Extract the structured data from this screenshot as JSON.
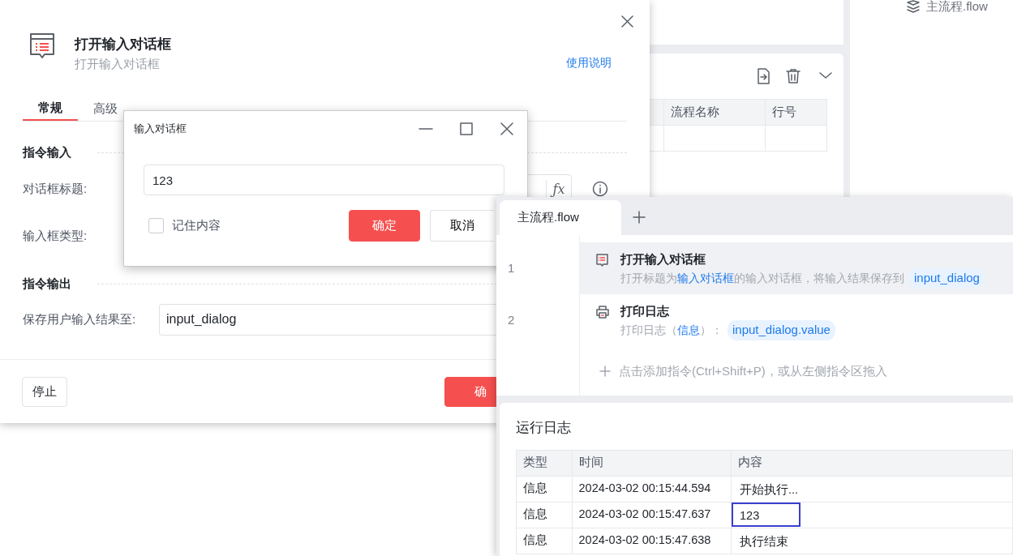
{
  "background_app": {
    "sidebar_file": "主流程.flow",
    "table": {
      "columns": [
        "流程名称",
        "行号"
      ]
    }
  },
  "instruction_dialog": {
    "title": "打开输入对话框",
    "subtitle": "打开输入对话框",
    "help_link": "使用说明",
    "tabs": [
      {
        "label": "常规",
        "selected": true
      },
      {
        "label": "高级",
        "selected": false
      }
    ],
    "sections": [
      {
        "title": "指令输入",
        "fields": [
          {
            "label": "对话框标题:",
            "kind": "expression",
            "fx": "ƒx"
          },
          {
            "label": "输入框类型:",
            "kind": "select"
          }
        ]
      },
      {
        "title": "指令输出",
        "fields": [
          {
            "label": "保存用户输入结果至:",
            "kind": "text",
            "value": "input_dialog"
          }
        ]
      }
    ],
    "buttons": [
      {
        "label": "停止",
        "kind": "default"
      },
      {
        "label": "确",
        "kind": "primary"
      }
    ]
  },
  "input_dialog": {
    "title": "输入对话框",
    "value": "123",
    "remember": {
      "label": "记住内容",
      "checked": false
    },
    "buttons": [
      {
        "label": "确定",
        "kind": "primary"
      },
      {
        "label": "取消",
        "kind": "default"
      }
    ]
  },
  "editor": {
    "tabs": [
      {
        "label": "主流程.flow",
        "selected": true
      }
    ],
    "steps": [
      {
        "line": "1",
        "title": "打开输入对话框",
        "selected": true,
        "parts": [
          {
            "text": "打开标题为",
            "kind": "plain"
          },
          {
            "text": "输入对话框",
            "kind": "link"
          },
          {
            "text": "的输入对话框，将输入结果保存到",
            "kind": "plain"
          },
          {
            "text": "input_dialog",
            "kind": "variable"
          }
        ]
      },
      {
        "line": "2",
        "title": "打印日志",
        "selected": false,
        "parts": [
          {
            "text": "打印日志（",
            "kind": "plain"
          },
          {
            "text": "信息",
            "kind": "link"
          },
          {
            "text": "）：",
            "kind": "plain"
          },
          {
            "text": "input_dialog.value",
            "kind": "variable"
          }
        ]
      }
    ],
    "add_hint": "点击添加指令(Ctrl+Shift+P)，或从左侧指令区拖入"
  },
  "run_log": {
    "title": "运行日志",
    "columns": [
      "类型",
      "时间",
      "内容"
    ],
    "rows": [
      {
        "type": "信息",
        "time": "2024-03-02 00:15:44.594",
        "content": "开始执行...",
        "content_focused": false
      },
      {
        "type": "信息",
        "time": "2024-03-02 00:15:47.637",
        "content": "123",
        "content_focused": true
      },
      {
        "type": "信息",
        "time": "2024-03-02 00:15:47.638",
        "content": "执行结束",
        "content_focused": false
      }
    ]
  }
}
